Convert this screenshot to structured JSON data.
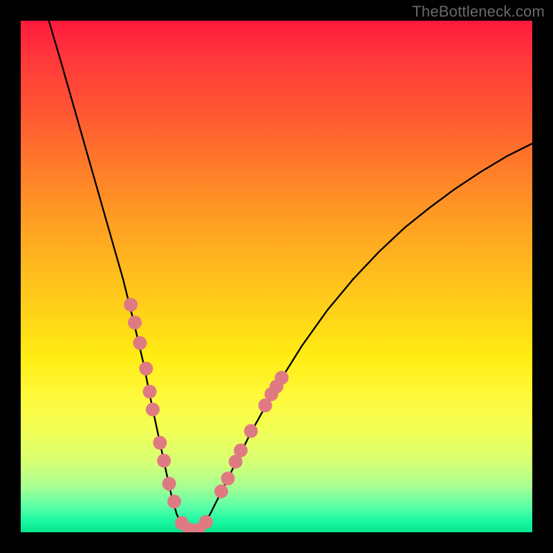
{
  "watermark": {
    "text": "TheBottleneck.com"
  },
  "chart_data": {
    "type": "line",
    "title": "",
    "xlabel": "",
    "ylabel": "",
    "xlim": [
      0,
      1
    ],
    "ylim": [
      0,
      1
    ],
    "series": [
      {
        "name": "curve",
        "x": [
          0.055,
          0.08,
          0.1,
          0.12,
          0.14,
          0.16,
          0.18,
          0.2,
          0.22,
          0.24,
          0.255,
          0.27,
          0.285,
          0.295,
          0.305,
          0.32,
          0.335,
          0.35,
          0.37,
          0.4,
          0.45,
          0.5,
          0.55,
          0.6,
          0.65,
          0.7,
          0.75,
          0.8,
          0.85,
          0.9,
          0.95,
          1.0
        ],
        "y": [
          1.0,
          0.915,
          0.845,
          0.775,
          0.705,
          0.635,
          0.565,
          0.495,
          0.415,
          0.33,
          0.255,
          0.185,
          0.115,
          0.07,
          0.035,
          0.005,
          0.0,
          0.005,
          0.035,
          0.095,
          0.195,
          0.285,
          0.365,
          0.435,
          0.495,
          0.548,
          0.595,
          0.635,
          0.672,
          0.705,
          0.735,
          0.76
        ]
      }
    ],
    "markers": {
      "name": "data-points",
      "color": "#e07a82",
      "radius_px": 10,
      "points": [
        {
          "x": 0.215,
          "y": 0.445
        },
        {
          "x": 0.223,
          "y": 0.41
        },
        {
          "x": 0.233,
          "y": 0.37
        },
        {
          "x": 0.245,
          "y": 0.32
        },
        {
          "x": 0.252,
          "y": 0.275
        },
        {
          "x": 0.258,
          "y": 0.24
        },
        {
          "x": 0.272,
          "y": 0.175
        },
        {
          "x": 0.28,
          "y": 0.14
        },
        {
          "x": 0.29,
          "y": 0.095
        },
        {
          "x": 0.3,
          "y": 0.06
        },
        {
          "x": 0.315,
          "y": 0.018
        },
        {
          "x": 0.33,
          "y": 0.005
        },
        {
          "x": 0.347,
          "y": 0.005
        },
        {
          "x": 0.362,
          "y": 0.02
        },
        {
          "x": 0.392,
          "y": 0.08
        },
        {
          "x": 0.405,
          "y": 0.105
        },
        {
          "x": 0.42,
          "y": 0.138
        },
        {
          "x": 0.43,
          "y": 0.16
        },
        {
          "x": 0.45,
          "y": 0.198
        },
        {
          "x": 0.478,
          "y": 0.248
        },
        {
          "x": 0.49,
          "y": 0.27
        },
        {
          "x": 0.5,
          "y": 0.285
        },
        {
          "x": 0.51,
          "y": 0.302
        }
      ]
    }
  }
}
